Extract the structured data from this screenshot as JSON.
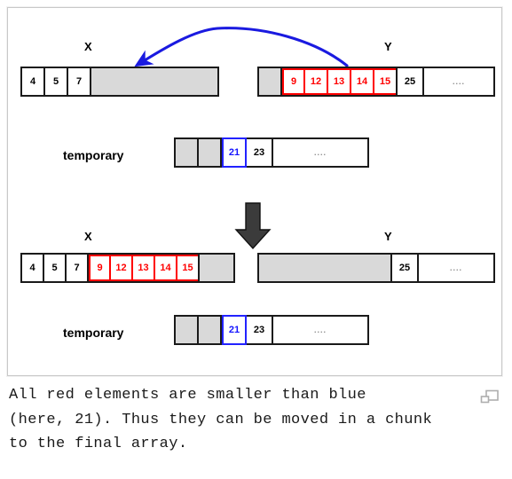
{
  "figure": {
    "top_section": {
      "x_label": "X",
      "y_label": "Y",
      "temporary_label": "temporary",
      "x_array": [
        {
          "value": "4",
          "style": "plain"
        },
        {
          "value": "5",
          "style": "plain"
        },
        {
          "value": "7",
          "style": "plain"
        },
        {
          "value": "",
          "style": "gray"
        }
      ],
      "y_array": [
        {
          "value": "",
          "style": "gray"
        },
        {
          "value": "9",
          "style": "red"
        },
        {
          "value": "12",
          "style": "red"
        },
        {
          "value": "13",
          "style": "red"
        },
        {
          "value": "14",
          "style": "red"
        },
        {
          "value": "15",
          "style": "red"
        },
        {
          "value": "25",
          "style": "plain"
        },
        {
          "value": "....",
          "style": "dots"
        }
      ],
      "temporary_array": [
        {
          "value": "",
          "style": "gray"
        },
        {
          "value": "",
          "style": "gray"
        },
        {
          "value": "21",
          "style": "blue"
        },
        {
          "value": "23",
          "style": "plain"
        },
        {
          "value": "....",
          "style": "dots"
        }
      ]
    },
    "bottom_section": {
      "x_label": "X",
      "y_label": "Y",
      "temporary_label": "temporary",
      "x_array": [
        {
          "value": "4",
          "style": "plain"
        },
        {
          "value": "5",
          "style": "plain"
        },
        {
          "value": "7",
          "style": "plain"
        },
        {
          "value": "9",
          "style": "red"
        },
        {
          "value": "12",
          "style": "red"
        },
        {
          "value": "13",
          "style": "red"
        },
        {
          "value": "14",
          "style": "red"
        },
        {
          "value": "15",
          "style": "red"
        },
        {
          "value": "",
          "style": "gray"
        }
      ],
      "y_array": [
        {
          "value": "",
          "style": "gray"
        },
        {
          "value": "25",
          "style": "plain"
        },
        {
          "value": "....",
          "style": "dots"
        }
      ],
      "temporary_array": [
        {
          "value": "",
          "style": "gray"
        },
        {
          "value": "",
          "style": "gray"
        },
        {
          "value": "21",
          "style": "blue"
        },
        {
          "value": "23",
          "style": "plain"
        },
        {
          "value": "....",
          "style": "dots"
        }
      ]
    },
    "arrows": {
      "move_chunk_arrow": "curved-arrow-y-to-x",
      "step_arrow": "down-arrow"
    }
  },
  "caption": {
    "line1": "All red elements are smaller than blue",
    "line2": "(here, 21). Thus they can be moved in a chunk",
    "line3": "to the final array."
  },
  "icons": {
    "expand": "expand-image-icon"
  },
  "colors": {
    "red": "#ff0000",
    "blue": "#1414ff",
    "gray_fill": "#d9d9d9",
    "outline": "#1a1a1a",
    "arrow_blue": "#1a1ae0",
    "arrow_dark": "#3a3a3a",
    "frame": "#c8c8c8"
  }
}
